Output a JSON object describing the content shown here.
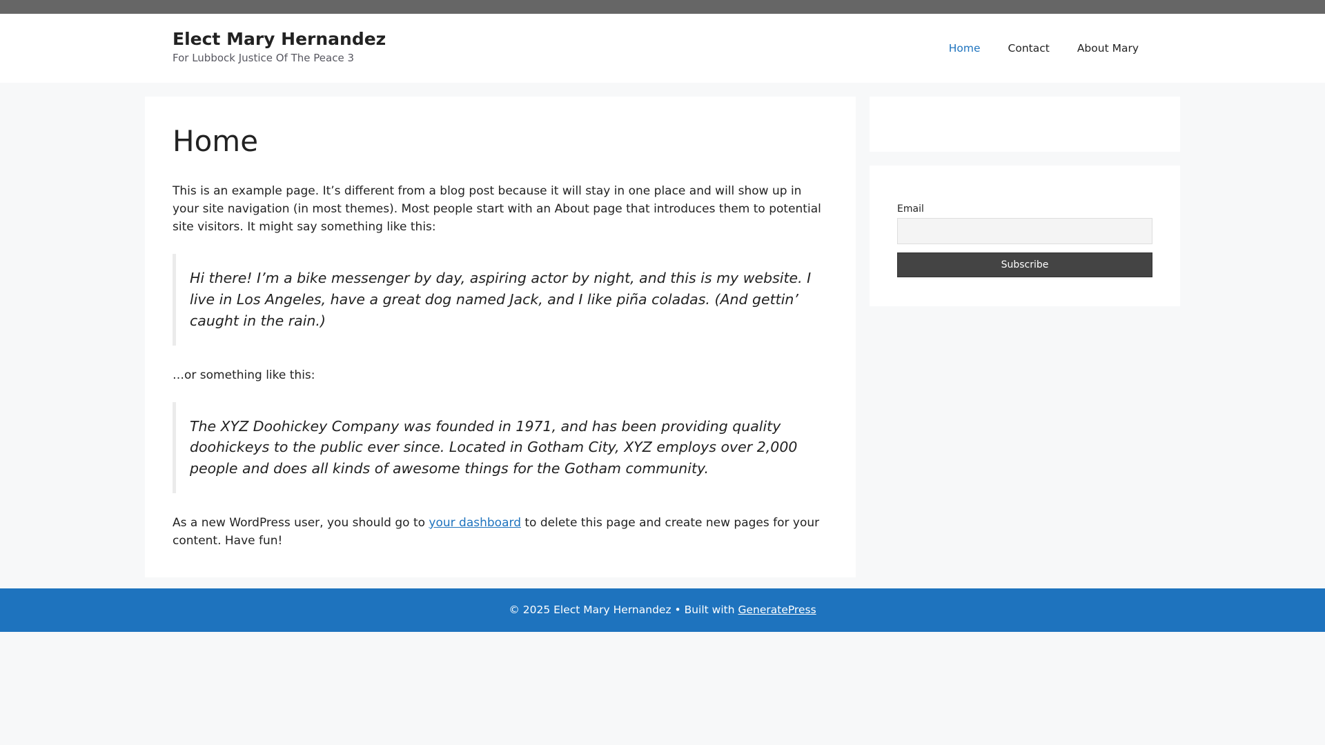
{
  "header": {
    "site_title": "Elect Mary Hernandez",
    "tagline": "For Lubbock Justice Of The Peace 3"
  },
  "nav": {
    "items": [
      {
        "label": "Home",
        "current": true
      },
      {
        "label": "Contact",
        "current": false
      },
      {
        "label": "About Mary",
        "current": false
      }
    ]
  },
  "main": {
    "page_title": "Home",
    "intro": "This is an example page. It’s different from a blog post because it will stay in one place and will show up in your site navigation (in most themes). Most people start with an About page that introduces them to potential site visitors. It might say something like this:",
    "quote_1": "Hi there! I’m a bike messenger by day, aspiring actor by night, and this is my website. I live in Los Angeles, have a great dog named Jack, and I like piña coladas. (And gettin’ caught in the rain.)",
    "middle": "…or something like this:",
    "quote_2": "The XYZ Doohickey Company was founded in 1971, and has been providing quality doohickeys to the public ever since. Located in Gotham City, XYZ employs over 2,000 people and does all kinds of awesome things for the Gotham community.",
    "outro_before": "As a new WordPress user, you should go to ",
    "outro_link": "your dashboard",
    "outro_after": " to delete this page and create new pages for your content. Have fun!"
  },
  "sidebar": {
    "email_label": "Email",
    "email_value": "",
    "subscribe_label": "Subscribe"
  },
  "footer": {
    "text": "© 2025 Elect Mary Hernandez • Built with ",
    "link": "GeneratePress"
  },
  "colors": {
    "accent": "#1e73be",
    "top_bar": "#666666",
    "page_bg": "#f7f8f9",
    "button_bg": "#444444"
  }
}
